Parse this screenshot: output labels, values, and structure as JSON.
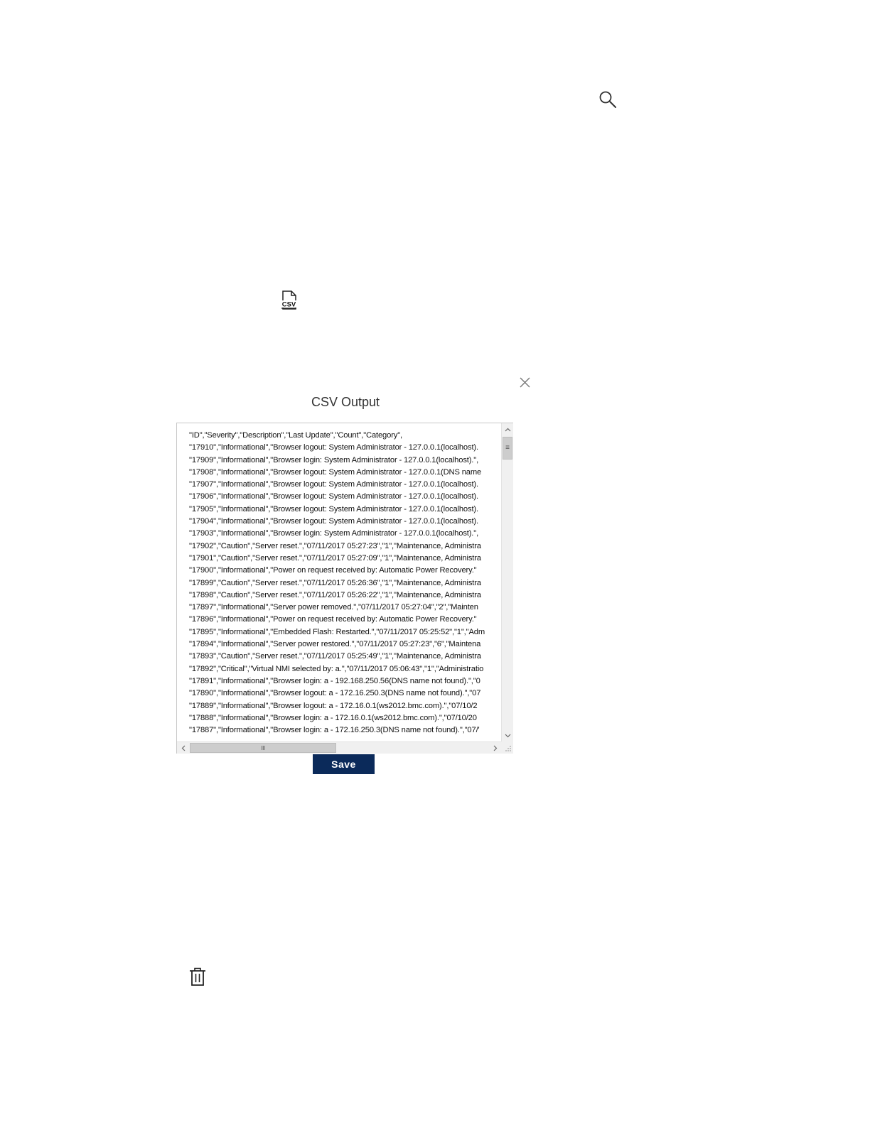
{
  "icons": {
    "search": "search-icon",
    "csv": "csv-file-icon",
    "close": "close-icon",
    "trash": "trash-icon"
  },
  "csv_icon_label": "CSV",
  "dialog": {
    "title": "CSV Output",
    "lines": [
      "\"ID\",\"Severity\",\"Description\",\"Last Update\",\"Count\",\"Category\",",
      "\"17910\",\"Informational\",\"Browser logout: System Administrator - 127.0.0.1(localhost).",
      "\"17909\",\"Informational\",\"Browser login: System Administrator - 127.0.0.1(localhost).\",",
      "\"17908\",\"Informational\",\"Browser logout: System Administrator - 127.0.0.1(DNS name",
      "\"17907\",\"Informational\",\"Browser logout: System Administrator - 127.0.0.1(localhost).",
      "\"17906\",\"Informational\",\"Browser logout: System Administrator - 127.0.0.1(localhost).",
      "\"17905\",\"Informational\",\"Browser logout: System Administrator - 127.0.0.1(localhost).",
      "\"17904\",\"Informational\",\"Browser logout: System Administrator - 127.0.0.1(localhost).",
      "\"17903\",\"Informational\",\"Browser login: System Administrator - 127.0.0.1(localhost).\",",
      "\"17902\",\"Caution\",\"Server reset.\",\"07/11/2017 05:27:23\",\"1\",\"Maintenance, Administra",
      "\"17901\",\"Caution\",\"Server reset.\",\"07/11/2017 05:27:09\",\"1\",\"Maintenance, Administra",
      "\"17900\",\"Informational\",\"Power on request received by: Automatic Power Recovery.\"",
      "\"17899\",\"Caution\",\"Server reset.\",\"07/11/2017 05:26:36\",\"1\",\"Maintenance, Administra",
      "\"17898\",\"Caution\",\"Server reset.\",\"07/11/2017 05:26:22\",\"1\",\"Maintenance, Administra",
      "\"17897\",\"Informational\",\"Server power removed.\",\"07/11/2017 05:27:04\",\"2\",\"Mainten",
      "\"17896\",\"Informational\",\"Power on request received by: Automatic Power Recovery.\"",
      "\"17895\",\"Informational\",\"Embedded Flash: Restarted.\",\"07/11/2017 05:25:52\",\"1\",\"Adm",
      "\"17894\",\"Informational\",\"Server power restored.\",\"07/11/2017 05:27:23\",\"6\",\"Maintena",
      "\"17893\",\"Caution\",\"Server reset.\",\"07/11/2017 05:25:49\",\"1\",\"Maintenance, Administra",
      "\"17892\",\"Critical\",\"Virtual NMI selected by: a.\",\"07/11/2017 05:06:43\",\"1\",\"Administratio",
      "\"17891\",\"Informational\",\"Browser login: a - 192.168.250.56(DNS name not found).\",\"0",
      "\"17890\",\"Informational\",\"Browser logout: a - 172.16.250.3(DNS name not found).\",\"07",
      "\"17889\",\"Informational\",\"Browser logout: a - 172.16.0.1(ws2012.bmc.com).\",\"07/10/2",
      "\"17888\",\"Informational\",\"Browser login: a - 172.16.0.1(ws2012.bmc.com).\",\"07/10/20",
      "\"17887\",\"Informational\",\"Browser login: a - 172.16.250.3(DNS name not found).\",\"07/'"
    ],
    "vscroll_grip": "≡",
    "hscroll_grip": "III",
    "save_label": "Save"
  }
}
